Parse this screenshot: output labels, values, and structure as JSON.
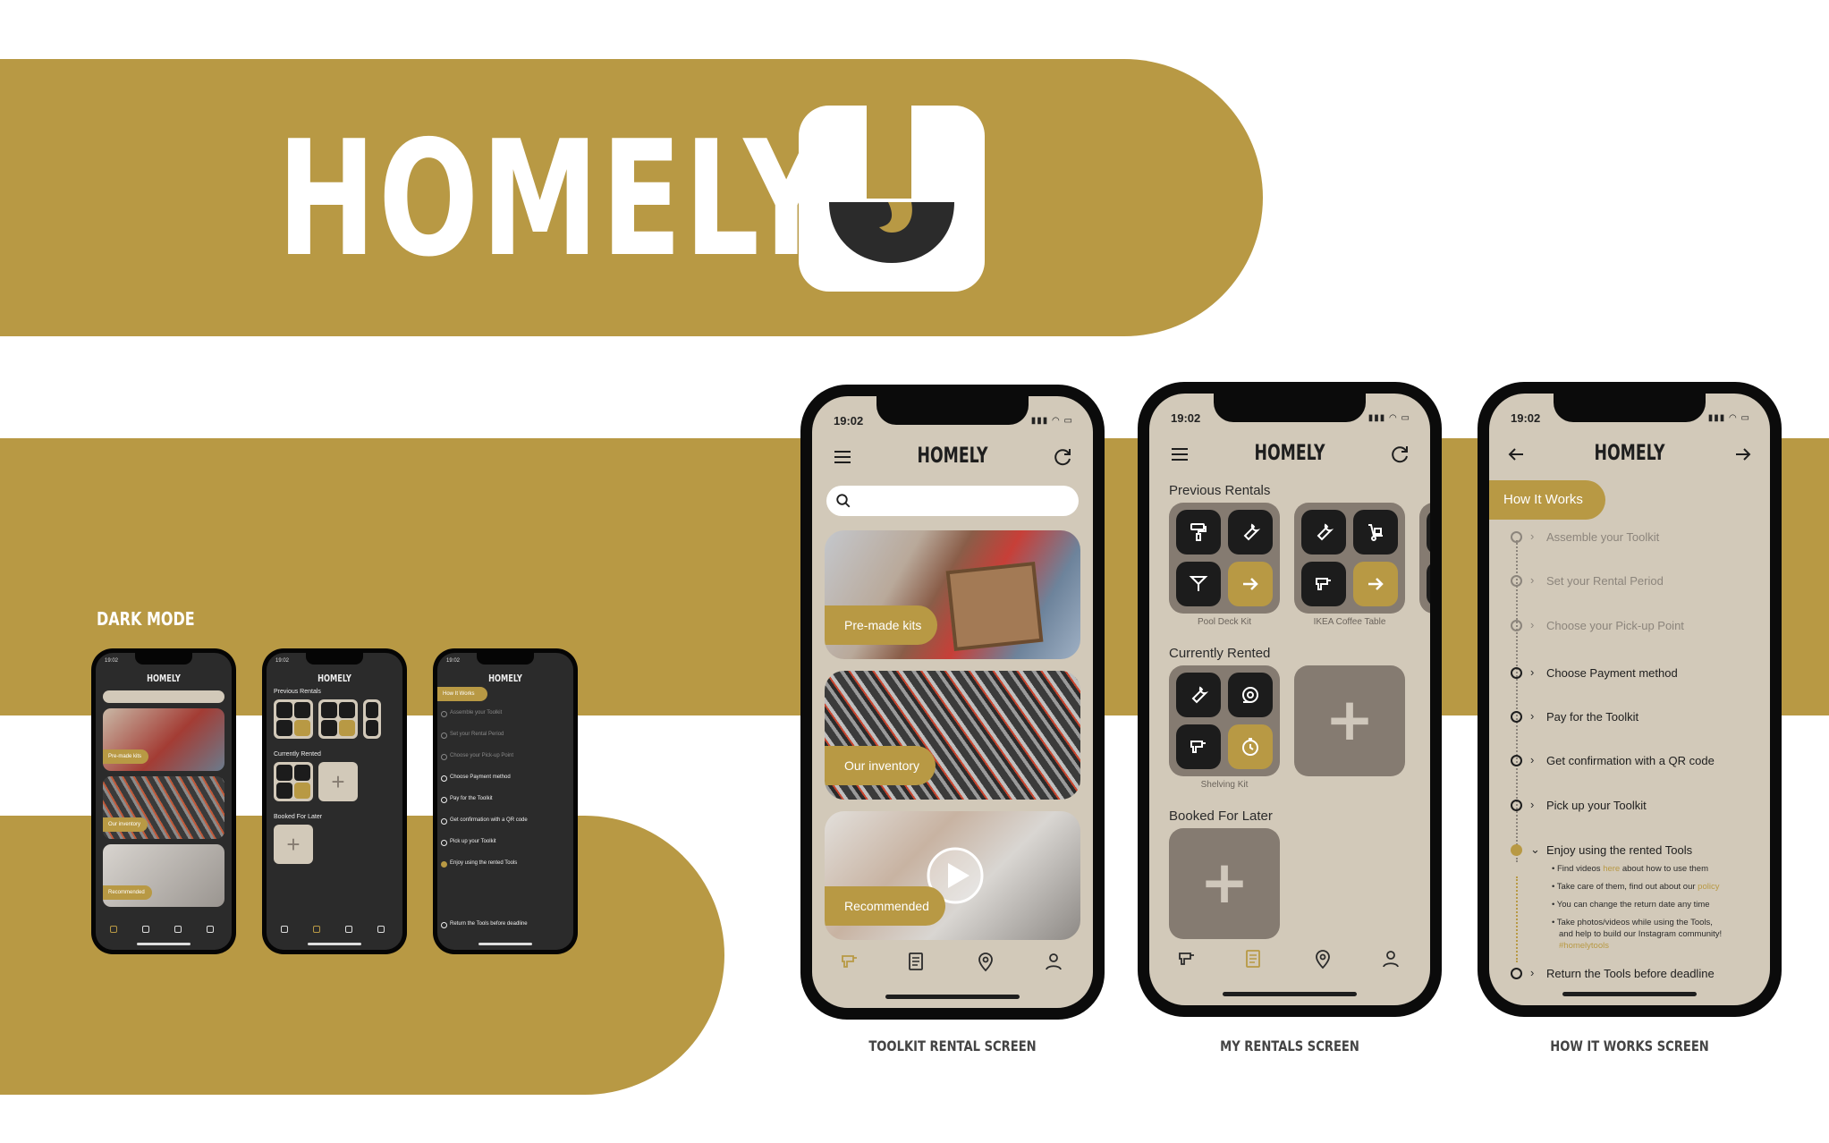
{
  "brand": {
    "title": "HOMELY",
    "gold": "#b89944",
    "beige": "#d2c9b9"
  },
  "labels": {
    "dark_mode": "DARK MODE"
  },
  "captions": [
    "TOOLKIT RENTAL SCREEN",
    "MY RENTALS SCREEN",
    "HOW IT WORKS SCREEN"
  ],
  "status_time": "19:02",
  "toolkit_screen": {
    "title": "HOMELY",
    "search_placeholder": "",
    "cards": [
      {
        "label": "Pre-made kits"
      },
      {
        "label": "Our inventory"
      },
      {
        "label": "Recommended"
      }
    ]
  },
  "rentals_screen": {
    "title": "HOMELY",
    "previous_rentals": "Previous Rentals",
    "currently_rented": "Currently Rented",
    "booked_for_later": "Booked For Later",
    "kits": [
      "Pool Deck Kit",
      "IKEA Coffee Table",
      "Shelving Kit"
    ],
    "add_symbol": "+"
  },
  "how_screen": {
    "title": "HOMELY",
    "header": "How It Works",
    "steps": [
      {
        "label": "Assemble your Toolkit",
        "state": "past"
      },
      {
        "label": "Set your Rental Period",
        "state": "past"
      },
      {
        "label": "Choose your Pick-up Point",
        "state": "past"
      },
      {
        "label": "Choose Payment method",
        "state": "todo"
      },
      {
        "label": "Pay for the Toolkit",
        "state": "todo"
      },
      {
        "label": "Get confirmation with a QR code",
        "state": "todo"
      },
      {
        "label": "Pick up your Toolkit",
        "state": "todo"
      },
      {
        "label": "Enjoy using the rented Tools",
        "state": "current"
      },
      {
        "label": "Return the Tools before deadline",
        "state": "todo"
      }
    ],
    "details": {
      "d1_a": "Find videos ",
      "d1_link": "here",
      "d1_b": " about how to use them",
      "d2_a": "Take care of them, find out about our ",
      "d2_link": "policy",
      "d3": "You can change the return date any time",
      "d4": "Take photos/videos while using the Tools,",
      "d4b": "and help to build our Instagram community!",
      "tag": "#homelytools"
    }
  },
  "dark_phones": {
    "title": "HOMELY",
    "time": "19:02",
    "kits_label": "Pre-made kits",
    "inventory_label": "Our inventory",
    "recommended_label": "Recommended",
    "previous_rentals": "Previous Rentals",
    "currently_rented": "Currently Rented",
    "booked_for_later": "Booked For Later",
    "how_header": "How It Works",
    "steps": [
      "Assemble your Toolkit",
      "Set your Rental Period",
      "Choose your Pick-up Point",
      "Choose Payment method",
      "Pay for the Toolkit",
      "Get confirmation with a QR code",
      "Pick up your Toolkit",
      "Enjoy using the rented Tools",
      "Return the Tools before deadline"
    ]
  }
}
